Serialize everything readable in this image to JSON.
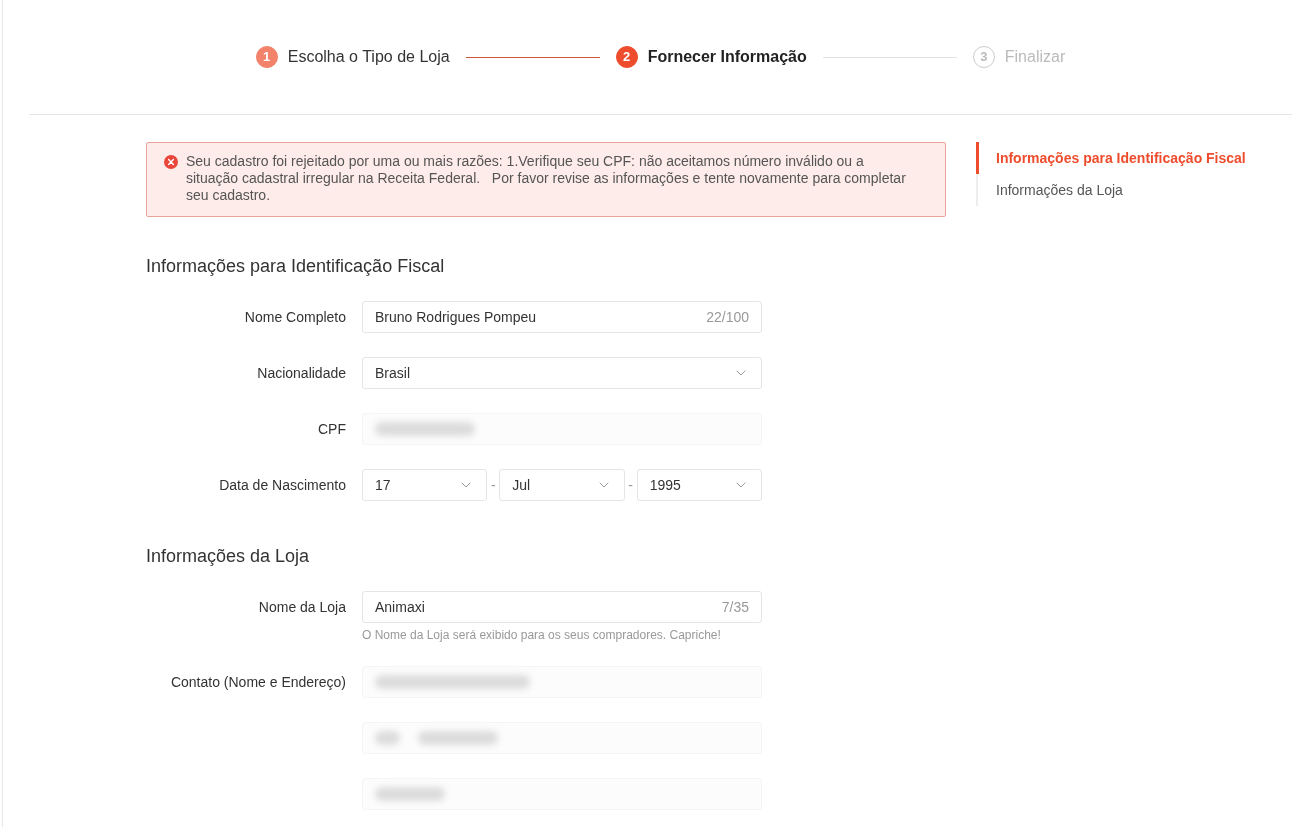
{
  "steps": [
    {
      "number": "1",
      "label": "Escolha o Tipo de Loja",
      "completed": true,
      "selected": false
    },
    {
      "number": "2",
      "label": "Fornecer Informação",
      "completed": false,
      "selected": true
    },
    {
      "number": "3",
      "label": "Finalizar",
      "completed": false,
      "selected": false
    }
  ],
  "alert": {
    "kind": "error",
    "message": "Seu cadastro foi rejeitado por uma ou mais razões: 1.Verifique seu CPF: não aceitamos número inválido ou a situação cadastral irregular na Receita Federal.   Por favor revise as informações e tente novamente para completar seu cadastro."
  },
  "sections": [
    {
      "title": "Informações para Identificação Fiscal",
      "rows": [
        {
          "label": "Nome Completo",
          "kind": "inline",
          "fields": [
            {
              "kind": "text",
              "value": "Bruno Rodrigues Pompeu",
              "counter": "22/100"
            }
          ]
        },
        {
          "label": "Nacionalidade",
          "kind": "inline",
          "fields": [
            {
              "kind": "select",
              "value": "Brasil"
            }
          ]
        },
        {
          "label": "CPF",
          "kind": "inline",
          "fields": [
            {
              "kind": "blurred"
            }
          ]
        },
        {
          "label": "Data de Nascimento",
          "kind": "inline",
          "separator": "-",
          "fields": [
            {
              "kind": "select",
              "value": "17"
            },
            {
              "kind": "select",
              "value": "Jul"
            },
            {
              "kind": "select",
              "value": "1995"
            }
          ]
        }
      ]
    },
    {
      "title": "Informações da Loja",
      "rows": [
        {
          "label": "Nome da Loja",
          "kind": "inline",
          "hint": "O Nome da Loja será exibido para os seus compradores. Capriche!",
          "fields": [
            {
              "kind": "text",
              "value": "Animaxi",
              "counter": "7/35"
            }
          ]
        },
        {
          "label": "Contato (Nome e Endereço)",
          "kind": "stacked",
          "fields": [
            {
              "kind": "blurred"
            },
            {
              "kind": "blurred"
            },
            {
              "kind": "blurred"
            }
          ]
        }
      ]
    }
  ],
  "nav": [
    {
      "label": "Informações para Identificação Fiscal",
      "selected": true
    },
    {
      "label": "Informações da Loja",
      "selected": false
    }
  ]
}
